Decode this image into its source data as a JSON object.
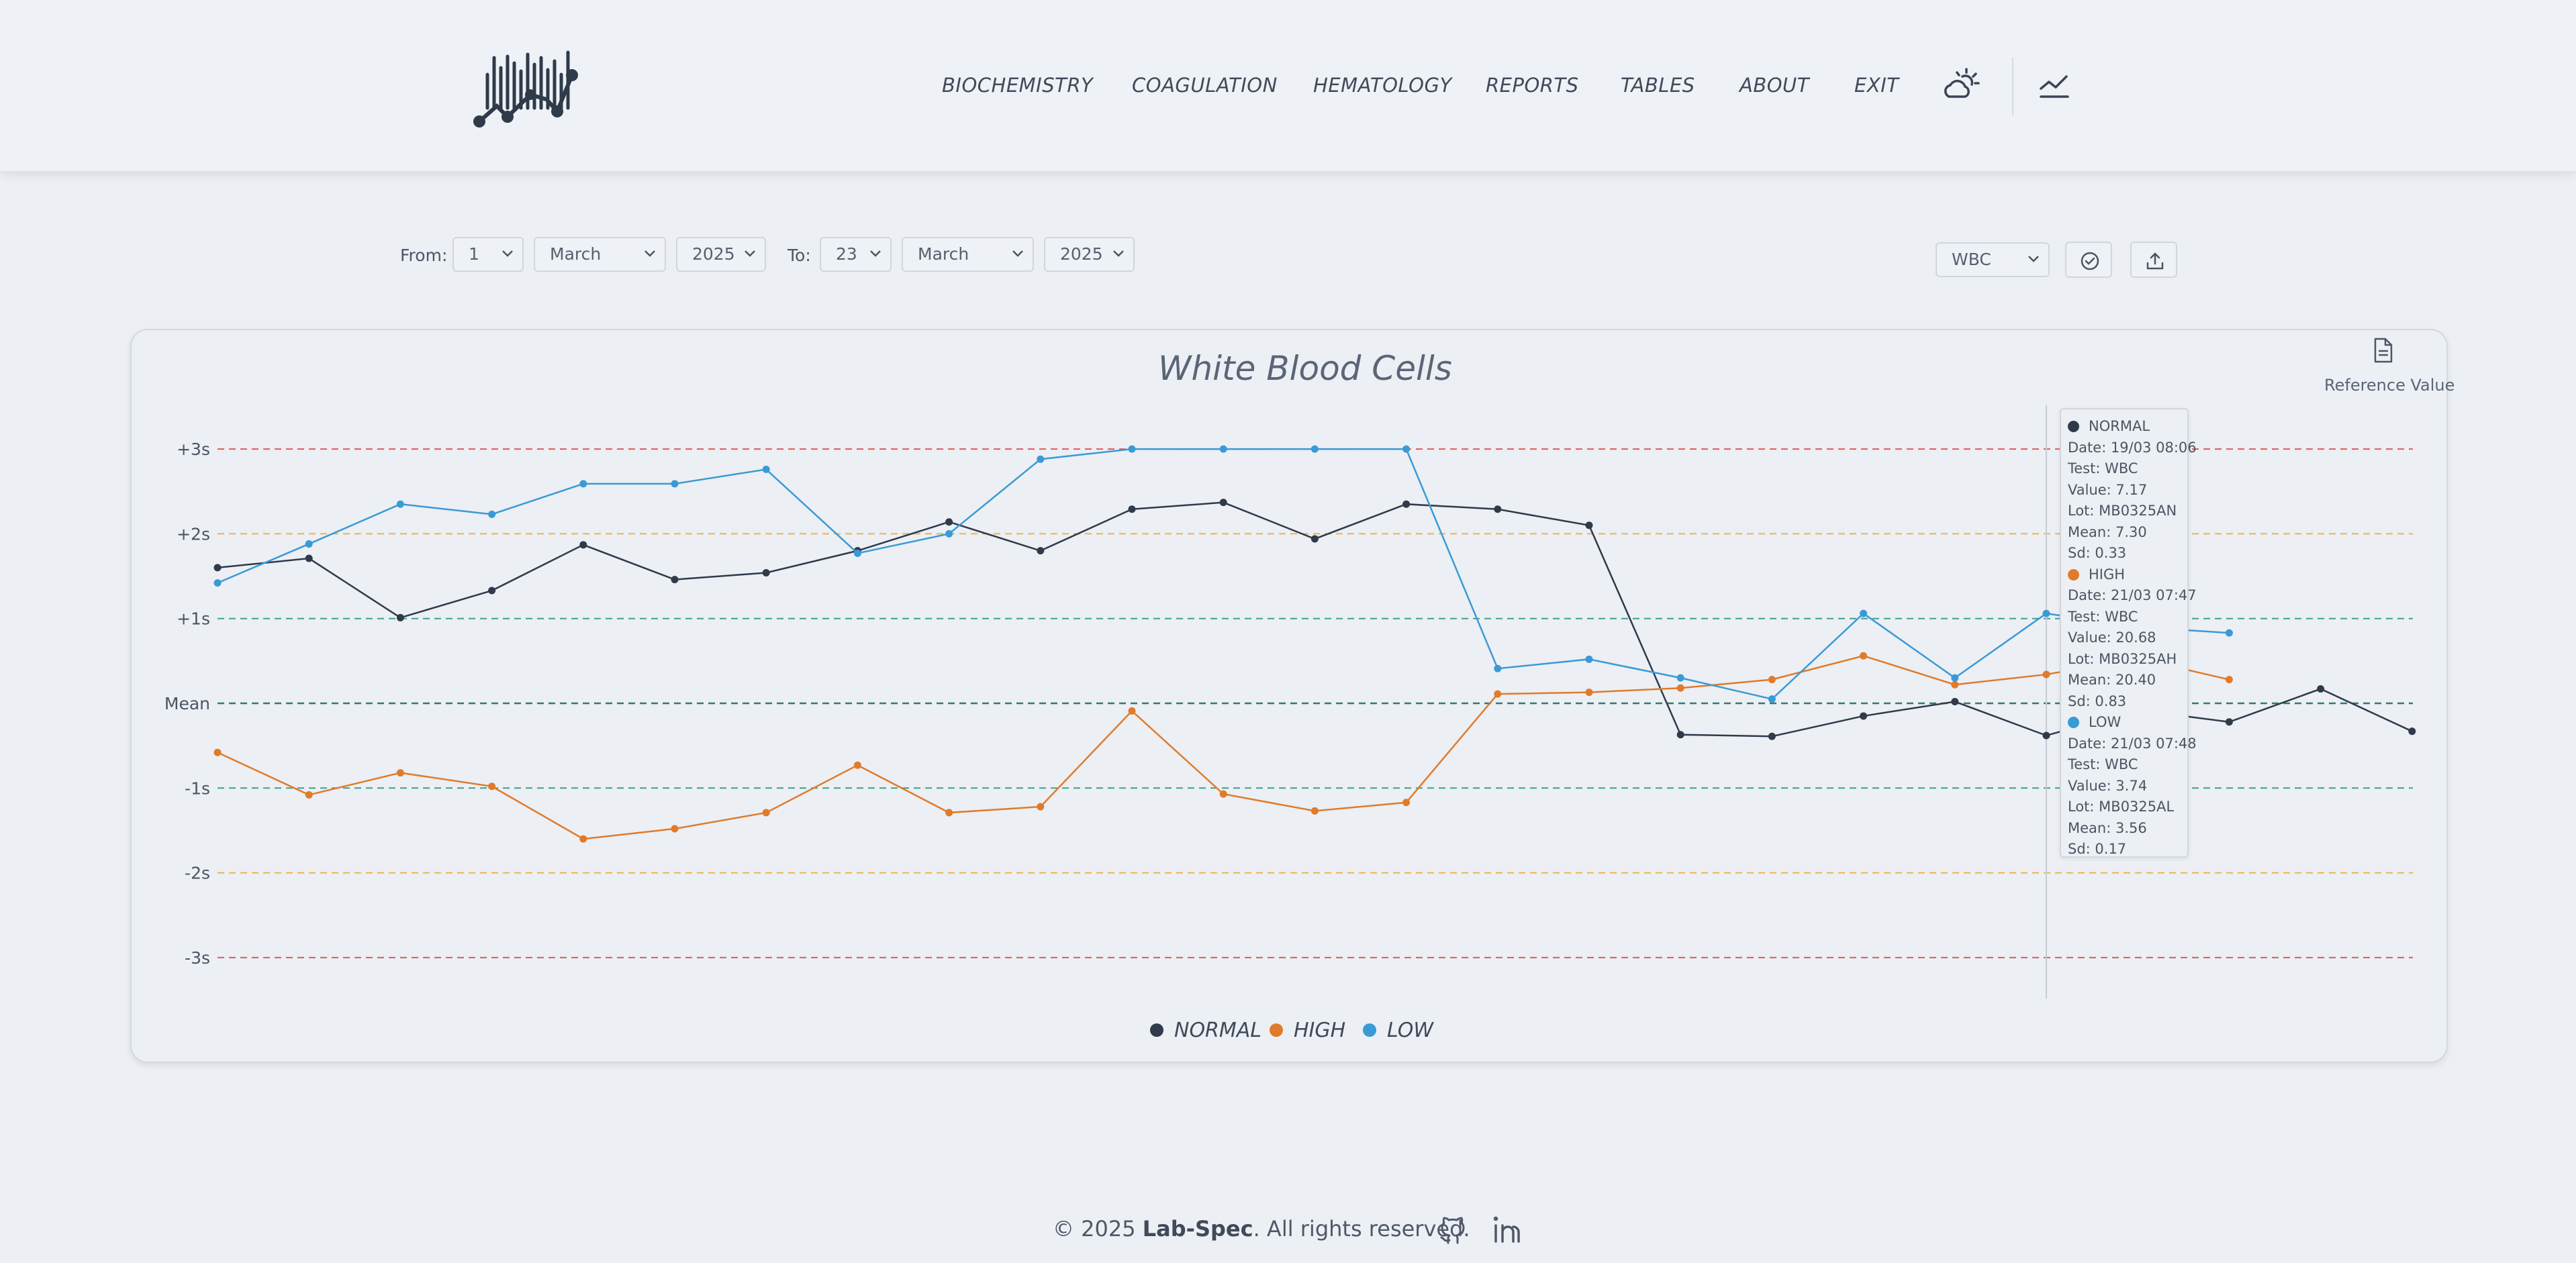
{
  "nav": {
    "items": [
      "BIOCHEMISTRY",
      "COAGULATION",
      "HEMATOLOGY",
      "REPORTS",
      "TABLES",
      "ABOUT",
      "EXIT"
    ],
    "icons": [
      "logo-icon",
      "weather-theme-icon",
      "line-chart-icon"
    ]
  },
  "filters": {
    "from_label": "From:",
    "to_label": "To:",
    "from_day": "1",
    "from_month": "March",
    "from_year": "2025",
    "to_day": "23",
    "to_month": "March",
    "to_year": "2025",
    "test": "WBC"
  },
  "chart_header": {
    "reference_label": "Reference Value"
  },
  "chart_data": {
    "type": "line",
    "title": "White Blood Cells",
    "y_tick_labels": [
      "+3s",
      "+2s",
      "+1s",
      "Mean",
      "-1s",
      "-2s",
      "-3s"
    ],
    "ylim": [
      -3,
      3
    ],
    "reference_lines": [
      {
        "level": 3,
        "color": "#e05a5a"
      },
      {
        "level": 2,
        "color": "#f0b24a"
      },
      {
        "level": 1,
        "color": "#3aa38a"
      },
      {
        "level": 0,
        "color": "#2e7d6b"
      },
      {
        "level": -1,
        "color": "#3aa38a"
      },
      {
        "level": -2,
        "color": "#f0b24a"
      },
      {
        "level": -3,
        "color": "#e05a5a"
      }
    ],
    "series": [
      {
        "name": "NORMAL",
        "color": "#2f3a4a",
        "values": [
          1.6,
          1.71,
          1.01,
          1.33,
          1.87,
          1.46,
          1.54,
          1.8,
          2.14,
          1.8,
          2.29,
          2.37,
          1.94,
          2.35,
          2.29,
          2.1,
          -0.37,
          -0.39,
          -0.15,
          0.02,
          -0.38,
          -0.08,
          -0.22,
          0.17,
          -0.33
        ]
      },
      {
        "name": "HIGH",
        "color": "#e07b2a",
        "values": [
          -0.58,
          -1.08,
          -0.82,
          -0.98,
          -1.6,
          -1.48,
          -1.29,
          -0.73,
          -1.29,
          -1.22,
          -0.09,
          -1.07,
          -1.27,
          -1.17,
          0.11,
          0.13,
          0.18,
          0.28,
          0.56,
          0.22,
          0.34,
          0.53,
          0.28,
          null,
          null
        ]
      },
      {
        "name": "LOW",
        "color": "#3a9ad6",
        "values": [
          1.42,
          1.88,
          2.35,
          2.23,
          2.59,
          2.59,
          2.76,
          1.77,
          2.0,
          2.88,
          3.0,
          3.0,
          3.0,
          3.0,
          0.41,
          0.52,
          0.3,
          0.05,
          1.06,
          0.3,
          1.06,
          0.9,
          0.83,
          null,
          null
        ]
      }
    ],
    "legend": [
      "NORMAL",
      "HIGH",
      "LOW"
    ],
    "legend_position": "bottom-center",
    "grid": false
  },
  "tooltip": {
    "entries": [
      {
        "name": "NORMAL",
        "color": "#2f3a4a",
        "lines": [
          "Date: 19/03 08:06",
          "Test: WBC",
          "Value: 7.17",
          "Lot: MB0325AN",
          "Mean: 7.30",
          "Sd: 0.33"
        ]
      },
      {
        "name": "HIGH",
        "color": "#e07b2a",
        "lines": [
          "Date: 21/03 07:47",
          "Test: WBC",
          "Value: 20.68",
          "Lot: MB0325AH",
          "Mean: 20.40",
          "Sd: 0.83"
        ]
      },
      {
        "name": "LOW",
        "color": "#3a9ad6",
        "lines": [
          "Date: 21/03 07:48",
          "Test: WBC",
          "Value: 3.74",
          "Lot: MB0325AL",
          "Mean: 3.56",
          "Sd: 0.17"
        ]
      }
    ]
  },
  "footer": {
    "prefix": "© 2025 ",
    "brand": "Lab-Spec",
    "suffix": ". All rights reserved.",
    "icons": [
      "github-icon",
      "linkedin-icon"
    ]
  }
}
